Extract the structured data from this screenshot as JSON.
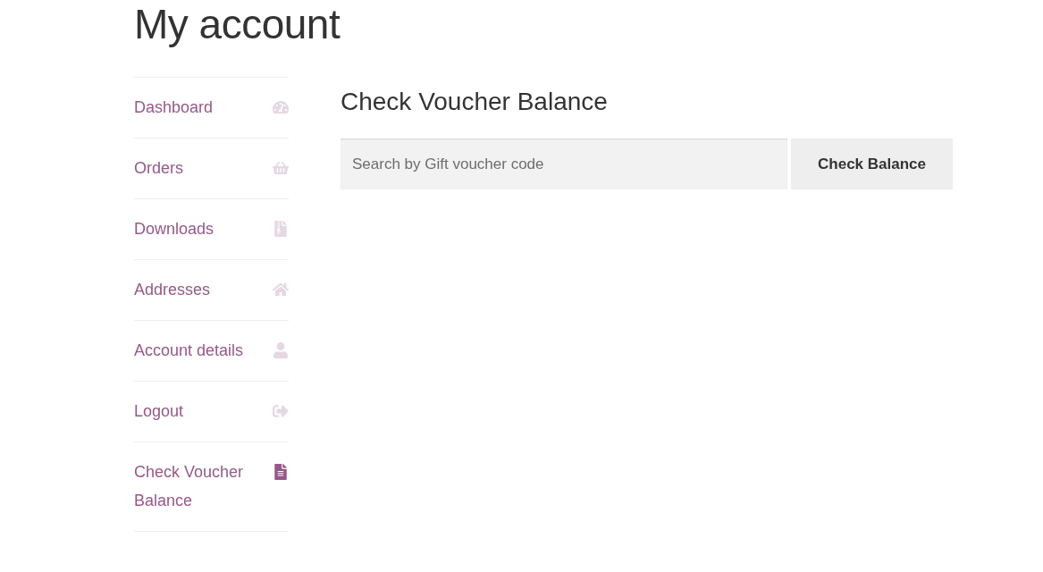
{
  "page": {
    "title": "My account"
  },
  "nav": {
    "items": [
      {
        "label": "Dashboard",
        "selected": false
      },
      {
        "label": "Orders",
        "selected": false
      },
      {
        "label": "Downloads",
        "selected": false
      },
      {
        "label": "Addresses",
        "selected": false
      },
      {
        "label": "Account details",
        "selected": false
      },
      {
        "label": "Logout",
        "selected": false
      },
      {
        "label": "Check Voucher Balance",
        "selected": true
      }
    ]
  },
  "content": {
    "heading": "Check Voucher Balance",
    "search": {
      "placeholder": "Search by Gift voucher code"
    },
    "button": "Check Balance"
  }
}
